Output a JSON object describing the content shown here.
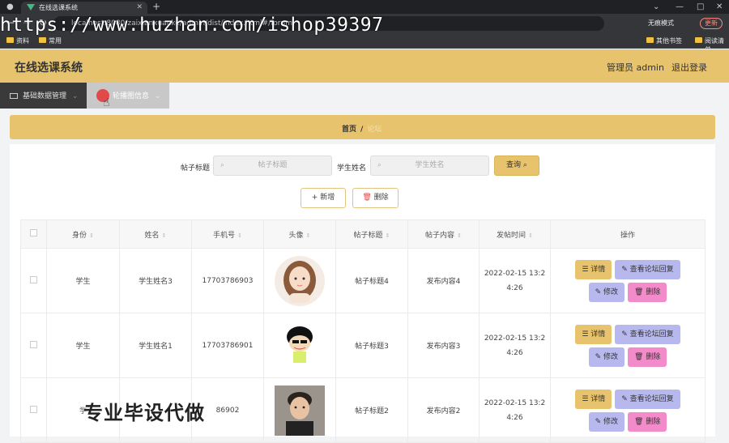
{
  "browser": {
    "tab_title": "在线选课系统",
    "url": "localhost:8080/zaixianxuanke/admin/dist/index.html#/forum",
    "incognito_label": "无痕模式",
    "update_label": "更新",
    "bookmarks": [
      "资料",
      "常用",
      "其他书签",
      "阅读清单"
    ],
    "watermark": "https://www.huzhan.com/ishop39397"
  },
  "app": {
    "title": "在线选课系统",
    "admin_label": "管理员 admin",
    "logout_label": "退出登录",
    "menu": [
      "基础数据管理",
      "轮播图信息"
    ],
    "breadcrumb": {
      "home": "首页",
      "separator": "/",
      "current": "论坛"
    }
  },
  "search": {
    "post_title_label": "帖子标题",
    "post_title_placeholder": "帖子标题",
    "student_name_label": "学生姓名",
    "student_name_placeholder": "学生姓名",
    "query_label": "查询"
  },
  "actions": {
    "add_label": "新增",
    "delete_label": "删除"
  },
  "table": {
    "columns": [
      "身份",
      "姓名",
      "手机号",
      "头像",
      "帖子标题",
      "帖子内容",
      "发帖时间",
      "操作"
    ],
    "rows": [
      {
        "role": "学生",
        "name": "学生姓名3",
        "phone": "17703786903",
        "title": "帖子标题4",
        "content": "发布内容4",
        "time_a": "2022-02-15 13:2",
        "time_b": "4:26",
        "avatar": "girl-avatar"
      },
      {
        "role": "学生",
        "name": "学生姓名1",
        "phone": "17703786901",
        "title": "帖子标题3",
        "content": "发布内容3",
        "time_a": "2022-02-15 13:2",
        "time_b": "4:26",
        "avatar": "cartoon-avatar"
      },
      {
        "role": "学",
        "name": "",
        "phone": "86902",
        "title": "帖子标题2",
        "content": "发布内容2",
        "time_a": "2022-02-15 13:2",
        "time_b": "4:26",
        "avatar": "boy-avatar"
      }
    ],
    "row_ops": {
      "detail": "详情",
      "reply": "查看论坛回复",
      "edit": "修改",
      "delete": "删除"
    }
  },
  "overlay_text": "专业毕设代做"
}
